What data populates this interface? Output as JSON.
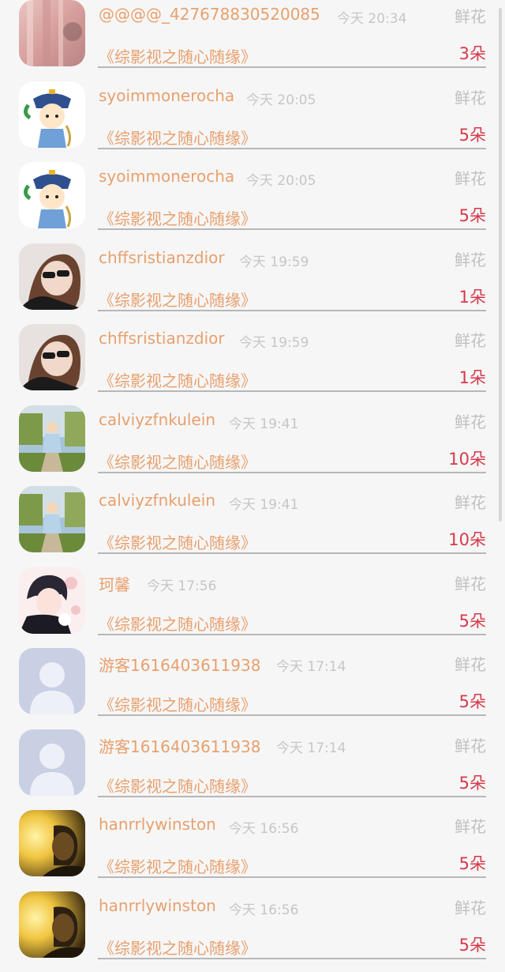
{
  "colors": {
    "name": "#e8a06d",
    "count": "#d63a4a",
    "time": "#c6c6c6",
    "gift": "#c0c0c0"
  },
  "rows": [
    {
      "user": "@@@@_427678830520085",
      "time": "今天 20:34",
      "gift": "鲜花",
      "book": "《综影视之随心随缘》",
      "count": "3朵",
      "avatar": "blurred-photo-avatar"
    },
    {
      "user": "syoimmonerocha",
      "time": "今天 20:05",
      "gift": "鲜花",
      "book": "《综影视之随心随缘》",
      "count": "5朵",
      "avatar": "qing-cartoon-avatar"
    },
    {
      "user": "syoimmonerocha",
      "time": "今天 20:05",
      "gift": "鲜花",
      "book": "《综影视之随心随缘》",
      "count": "5朵",
      "avatar": "qing-cartoon-avatar"
    },
    {
      "user": "chffsristianzdior",
      "time": "今天 19:59",
      "gift": "鲜花",
      "book": "《综影视之随心随缘》",
      "count": "1朵",
      "avatar": "sunglasses-woman-avatar"
    },
    {
      "user": "chffsristianzdior",
      "time": "今天 19:59",
      "gift": "鲜花",
      "book": "《综影视之随心随缘》",
      "count": "1朵",
      "avatar": "sunglasses-woman-avatar"
    },
    {
      "user": "calviyzfnkulein",
      "time": "今天 19:41",
      "gift": "鲜花",
      "book": "《综影视之随心随缘》",
      "count": "10朵",
      "avatar": "child-park-avatar"
    },
    {
      "user": "calviyzfnkulein",
      "time": "今天 19:41",
      "gift": "鲜花",
      "book": "《综影视之随心随缘》",
      "count": "10朵",
      "avatar": "child-park-avatar"
    },
    {
      "user": "珂馨",
      "time": "今天 17:56",
      "gift": "鲜花",
      "book": "《综影视之随心随缘》",
      "count": "5朵",
      "avatar": "anime-boy-avatar"
    },
    {
      "user": "游客1616403611938",
      "time": "今天 17:14",
      "gift": "鲜花",
      "book": "《综影视之随心随缘》",
      "count": "5朵",
      "avatar": "default-user-avatar"
    },
    {
      "user": "游客1616403611938",
      "time": "今天 17:14",
      "gift": "鲜花",
      "book": "《综影视之随心随缘》",
      "count": "5朵",
      "avatar": "default-user-avatar"
    },
    {
      "user": "hanrrlywinston",
      "time": "今天 16:56",
      "gift": "鲜花",
      "book": "《综影视之随心随缘》",
      "count": "5朵",
      "avatar": "golden-light-man-avatar"
    },
    {
      "user": "hanrrlywinston",
      "time": "今天 16:56",
      "gift": "鲜花",
      "book": "《综影视之随心随缘》",
      "count": "5朵",
      "avatar": "golden-light-man-avatar"
    }
  ]
}
